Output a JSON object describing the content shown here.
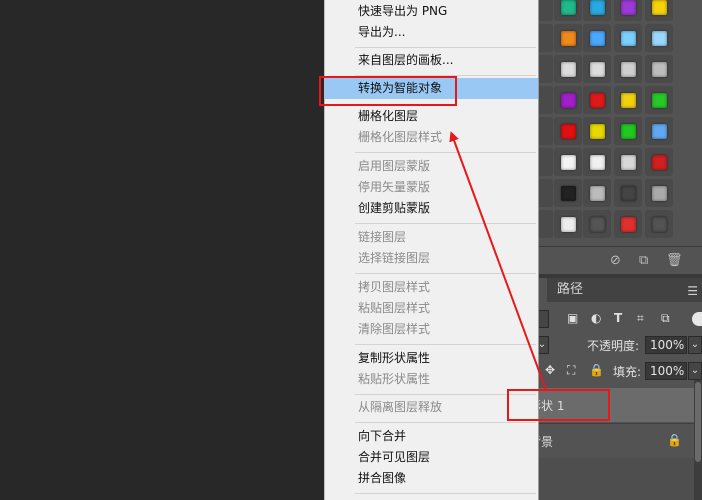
{
  "menu": {
    "items": [
      {
        "label": "快速导出为 PNG",
        "disabled": false
      },
      {
        "label": "导出为...",
        "disabled": false
      },
      {
        "label": "来自图层的画板...",
        "disabled": false
      },
      {
        "label": "转换为智能对象",
        "disabled": false,
        "highlighted": true
      },
      {
        "label": "栅格化图层",
        "disabled": false
      },
      {
        "label": "栅格化图层样式",
        "disabled": true
      },
      {
        "label": "启用图层蒙版",
        "disabled": true
      },
      {
        "label": "停用矢量蒙版",
        "disabled": true
      },
      {
        "label": "创建剪贴蒙版",
        "disabled": false
      },
      {
        "label": "链接图层",
        "disabled": true
      },
      {
        "label": "选择链接图层",
        "disabled": true
      },
      {
        "label": "拷贝图层样式",
        "disabled": true
      },
      {
        "label": "粘贴图层样式",
        "disabled": true
      },
      {
        "label": "清除图层样式",
        "disabled": true
      },
      {
        "label": "复制形状属性",
        "disabled": false
      },
      {
        "label": "粘贴形状属性",
        "disabled": true
      },
      {
        "label": "从隔离图层释放",
        "disabled": true
      },
      {
        "label": "向下合并",
        "disabled": false
      },
      {
        "label": "合并可见图层",
        "disabled": false
      },
      {
        "label": "拼合图像",
        "disabled": false
      }
    ],
    "highlight_color": "#99c8f5"
  },
  "layers_panel": {
    "tab_paths": "路径",
    "menu_icon": "panel-menu-icon",
    "filter_icons": [
      "image-filter-icon",
      "adjustment-filter-icon",
      "type-filter-icon",
      "shape-filter-icon",
      "smart-object-filter-icon"
    ],
    "opacity_label": "不透明度:",
    "opacity_value": "100%",
    "fill_label": "填充:",
    "fill_value": "100%",
    "lock_icons": [
      "move-lock-icon",
      "artboard-lock-icon",
      "lock-all-icon"
    ],
    "layers": [
      {
        "name": "形状 1",
        "selected": true
      },
      {
        "name": "背景",
        "selected": false,
        "locked": true
      }
    ]
  },
  "styles_panel": {
    "toolbar_icons": [
      "clear-style-icon",
      "new-style-icon",
      "delete-style-icon"
    ],
    "swatch_colors": [
      [
        "#1fb98a",
        "#2aa8e0",
        "#9b3ad6",
        "#f4d20c"
      ],
      [
        "#f08a1a",
        "#4aa8ff",
        "#7ad0ff",
        "#9ad8ff"
      ],
      [
        "#dcdcdc",
        "#dcdcdc",
        "#cfcfcf",
        "#bdbdbd"
      ],
      [
        "#a020c8",
        "#e01818",
        "#f0d010",
        "#28c828"
      ],
      [
        "#e01010",
        "#e8d800",
        "#20c820",
        "#60a8f0"
      ],
      [
        "#f4f4f4",
        "#f0f0f0",
        "#d8d8d8",
        "#d02020"
      ],
      [
        "#222222",
        "#bbbbbb",
        "#444444",
        "#aaaaaa"
      ],
      [
        "#eeeeee",
        "#555555",
        "#e03030",
        "#535353"
      ]
    ]
  },
  "annotation_color": "#e8181a"
}
